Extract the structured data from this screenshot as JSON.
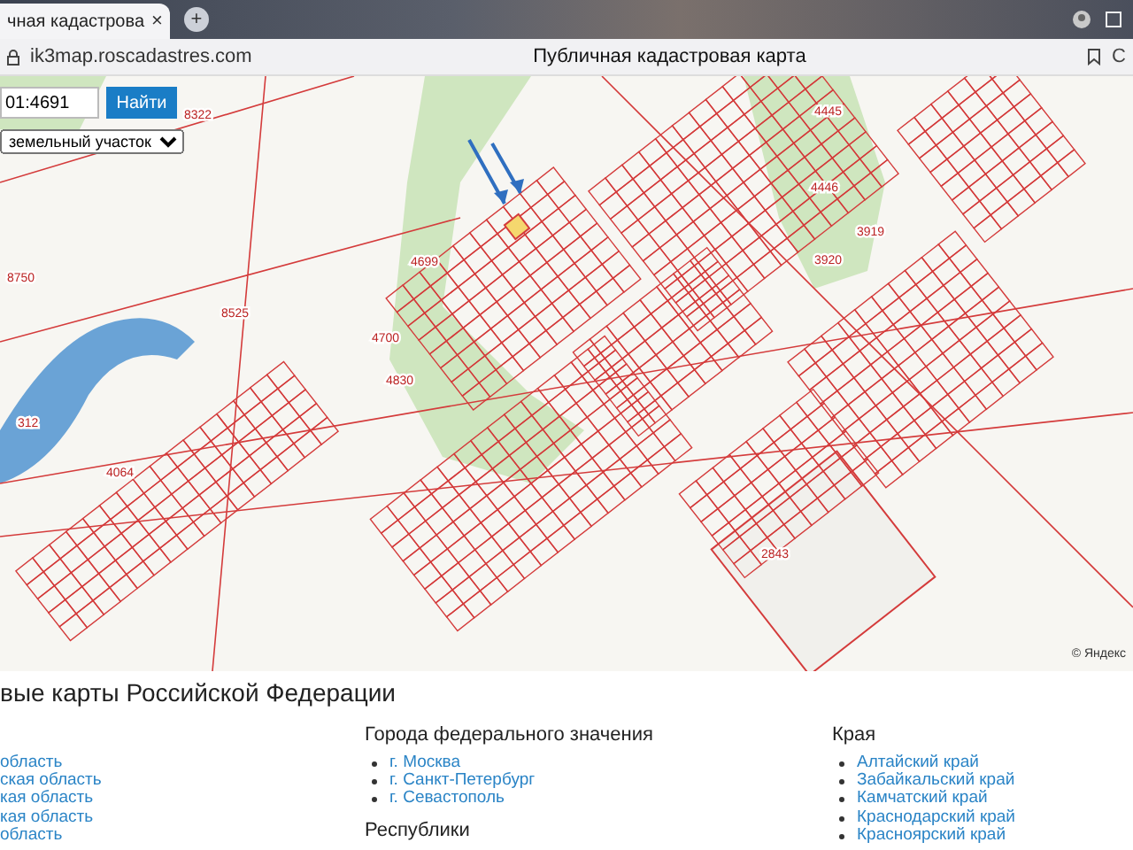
{
  "browser": {
    "tab": {
      "title": "чная кадастрова",
      "close": "×"
    },
    "new_tab": "+",
    "url": "ik3map.roscadastres.com",
    "page_title": "Публичная кадастровая карта",
    "side_label": "С"
  },
  "map": {
    "search": {
      "value": "01:4691",
      "button": "Найти",
      "type_select": "земельный участок"
    },
    "labels": [
      "8322",
      "8750",
      "8525",
      "312",
      "4064",
      "4699",
      "4700",
      "4830",
      "4445",
      "4446",
      "3919",
      "3920",
      "2843"
    ],
    "copyright": "© Яндекс"
  },
  "footer": {
    "heading": "вые карты Российской Федерации",
    "columns": [
      {
        "items": [
          "область",
          "ская область",
          "кая область",
          "кая область",
          "область"
        ]
      },
      {
        "title": "Города федерального значения",
        "items": [
          "г. Москва",
          "г. Санкт-Петербург",
          "г. Севастополь"
        ],
        "next_title": "Республики"
      },
      {
        "title": "Края",
        "items": [
          "Алтайский край",
          "Забайкальский край",
          "Камчатский край",
          "Краснодарский край",
          "Красноярский край"
        ]
      }
    ]
  }
}
